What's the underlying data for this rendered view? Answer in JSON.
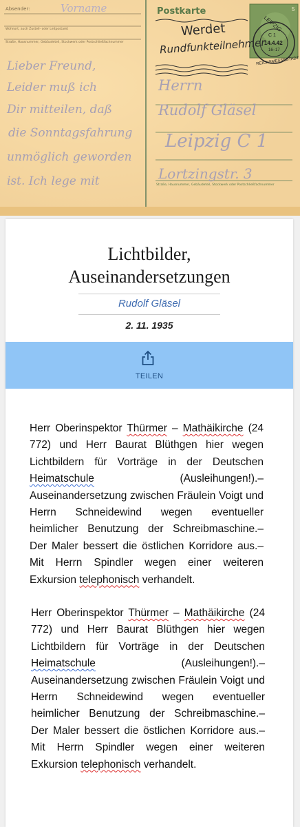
{
  "postcard": {
    "sender_label": "Absender:",
    "sender_hand": "Vorname",
    "address_line1_label": "Wohnort, auch Zustell- oder Leitpostamt",
    "address_line2_label": "Straße, Hausnummer, Gebäudeteil, Stockwerk oder Postschließfachnummer",
    "header": "Postkarte",
    "postmark_slogan_1": "Werdet",
    "postmark_slogan_2": "Rundfunkteilnehmer",
    "postmark_city": "LEIPZIG",
    "postmark_code": "C 1",
    "postmark_date": "14.4.42",
    "postmark_time": "16–17",
    "postmark_fair": "REICHSMESSESTADT",
    "stamp_value": "5",
    "message_lines": [
      "Lieber Freund,",
      "Leider muß ich",
      "Dir mitteilen, daß",
      "die Sonntagsfahrung",
      "unmöglich geworden",
      "ist. Ich lege mit"
    ],
    "recipient_lines": [
      "Herrn",
      "Rudolf Gläsel",
      "Leipzig C 1",
      "Lortzingstr. 3"
    ],
    "recipient_footer_label": "Straße, Hausnummer, Gebäudeteil, Stockwerk oder Postschließfachnummer"
  },
  "article": {
    "title_line1": "Lichtbilder,",
    "title_line2": "Auseinandersetzungen",
    "author": "Rudolf Gläsel",
    "date": "2. 11. 1935",
    "share_label": "TEILEN",
    "paragraphs": [
      {
        "pre1": "Herr Oberinspektor ",
        "w_thuermer": "Thürmer",
        "mid1": " – ",
        "w_mathaeikirche": "Mathäikirche",
        "mid2": " (24 772) und Herr Baurat Blüthgen hier wegen Lichtbildern für Vorträge in der Deutschen ",
        "w_heimatschule": "Heimatschule",
        "mid3": "  (Ausleihungen!).– Auseinandersetzung zwischen Fräulein Voigt und Herrn Schneidewind wegen eventueller heimlicher Benutzung der Schreibmaschine.– Der Maler bessert die östlichen Korridore aus.– Mit Herrn Spindler wegen einer weiteren Exkursion ",
        "w_telephonisch": "telephonisch",
        "post": " verhandelt."
      },
      {
        "pre1": "Herr Oberinspektor ",
        "w_thuermer": "Thürmer",
        "mid1": " – ",
        "w_mathaeikirche": "Mathäikirche",
        "mid2": " (24 772) und Herr Baurat Blüthgen hier wegen Lichtbildern für Vorträge in der Deutschen ",
        "w_heimatschule": "Heimatschule",
        "mid3": "  (Ausleihungen!).– Auseinandersetzung zwischen Fräulein Voigt und Herrn Schneidewind wegen eventueller heimlicher Benutzung der Schreibmaschine.– Der Maler bessert die östlichen Korridore aus.– Mit Herrn Spindler wegen einer weiteren Exkursion ",
        "w_telephonisch": "telephonisch",
        "post": " verhandelt."
      }
    ]
  },
  "colors": {
    "postcard_paper": "#f2d29b",
    "share_bar": "#90c5f6",
    "author_link": "#3f6cb1",
    "spell_red": "#d33",
    "spell_blue": "#3b6fd6"
  }
}
